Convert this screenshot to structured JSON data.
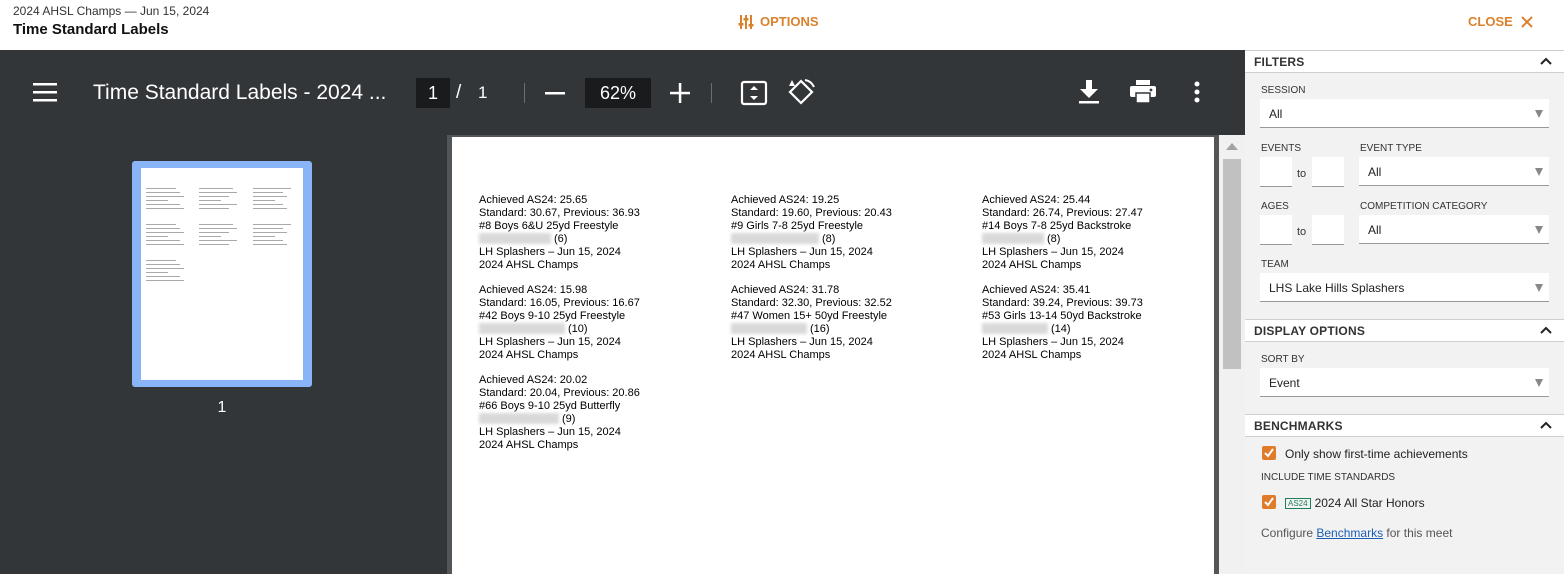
{
  "header": {
    "meet_subtitle": "2024 AHSL Champs — Jun 15, 2024",
    "title": "Time Standard Labels",
    "options_label": "OPTIONS",
    "close_label": "CLOSE"
  },
  "viewer": {
    "doc_title": "Time Standard Labels - 2024 ...",
    "current_page": "1",
    "page_separator": "/",
    "total_pages": "1",
    "zoom": "62%",
    "thumbnail_page_number": "1",
    "icons": [
      "menu-icon",
      "zoom-out-icon",
      "zoom-in-icon",
      "fit-page-icon",
      "rotate-icon",
      "download-icon",
      "print-icon",
      "more-vert-icon"
    ]
  },
  "labels": [
    {
      "achieved": "Achieved AS24: 25.65",
      "standard": "Standard: 30.67, Previous: 36.93",
      "event": "#8 Boys 6&U 25yd Freestyle",
      "age": "(6)",
      "team_date": "LH Splashers – Jun 15, 2024",
      "meet": "2024 AHSL Champs"
    },
    {
      "achieved": "Achieved AS24: 19.25",
      "standard": "Standard: 19.60, Previous: 20.43",
      "event": "#9 Girls 7-8 25yd Freestyle",
      "age": "(8)",
      "team_date": "LH Splashers – Jun 15, 2024",
      "meet": "2024 AHSL Champs"
    },
    {
      "achieved": "Achieved AS24: 25.44",
      "standard": "Standard: 26.74, Previous: 27.47",
      "event": "#14 Boys 7-8 25yd Backstroke",
      "age": "(8)",
      "team_date": "LH Splashers – Jun 15, 2024",
      "meet": "2024 AHSL Champs"
    },
    {
      "achieved": "Achieved AS24: 15.98",
      "standard": "Standard: 16.05, Previous: 16.67",
      "event": "#42 Boys 9-10 25yd Freestyle",
      "age": "(10)",
      "team_date": "LH Splashers – Jun 15, 2024",
      "meet": "2024 AHSL Champs"
    },
    {
      "achieved": "Achieved AS24: 31.78",
      "standard": "Standard: 32.30, Previous: 32.52",
      "event": "#47 Women 15+ 50yd Freestyle",
      "age": "(16)",
      "team_date": "LH Splashers – Jun 15, 2024",
      "meet": "2024 AHSL Champs"
    },
    {
      "achieved": "Achieved AS24: 35.41",
      "standard": "Standard: 39.24, Previous: 39.73",
      "event": "#53 Girls 13-14 50yd Backstroke",
      "age": "(14)",
      "team_date": "LH Splashers – Jun 15, 2024",
      "meet": "2024 AHSL Champs"
    },
    {
      "achieved": "Achieved AS24: 20.02",
      "standard": "Standard: 20.04, Previous: 20.86",
      "event": "#66 Boys 9-10 25yd Butterfly",
      "age": "(9)",
      "team_date": "LH Splashers – Jun 15, 2024",
      "meet": "2024 AHSL Champs"
    }
  ],
  "sidebar": {
    "filters": {
      "heading": "FILTERS",
      "session_label": "SESSION",
      "session_value": "All",
      "events_label": "EVENTS",
      "events_to": "to",
      "event_type_label": "EVENT TYPE",
      "event_type_value": "All",
      "ages_label": "AGES",
      "ages_to": "to",
      "competition_category_label": "COMPETITION CATEGORY",
      "competition_category_value": "All",
      "team_label": "TEAM",
      "team_value": "LHS Lake Hills Splashers"
    },
    "display_options": {
      "heading": "DISPLAY OPTIONS",
      "sort_by_label": "SORT BY",
      "sort_by_value": "Event"
    },
    "benchmarks": {
      "heading": "BENCHMARKS",
      "first_time_label": "Only show first-time achievements",
      "first_time_checked": true,
      "include_label": "INCLUDE TIME STANDARDS",
      "standard_badge": "AS24",
      "standard_label": "2024 All Star Honors",
      "standard_checked": true,
      "configure_prefix": "Configure",
      "configure_link": "Benchmarks",
      "configure_suffix": "for this meet"
    }
  },
  "colors": {
    "accent": "#d9822b",
    "checkbox": "#e07b2a",
    "viewer_toolbar": "#323639",
    "viewer_bg": "#525659",
    "thumb_highlight": "#8ab4f8"
  }
}
